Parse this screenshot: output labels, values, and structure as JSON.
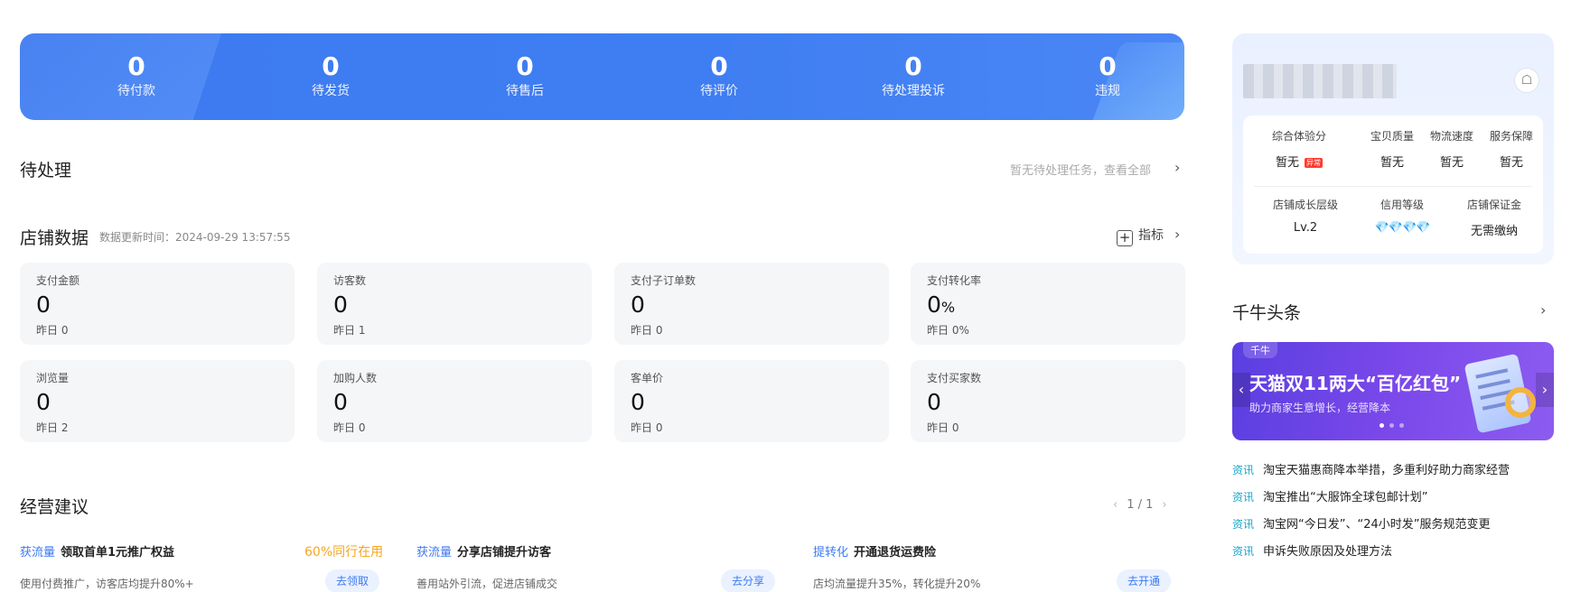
{
  "summary": [
    {
      "value": "0",
      "label": "待付款"
    },
    {
      "value": "0",
      "label": "待发货"
    },
    {
      "value": "0",
      "label": "待售后"
    },
    {
      "value": "0",
      "label": "待评价"
    },
    {
      "value": "0",
      "label": "待处理投诉"
    },
    {
      "value": "0",
      "label": "违规"
    }
  ],
  "pending": {
    "title": "待处理",
    "link": "暂无待处理任务，查看全部"
  },
  "store_data": {
    "title": "店铺数据",
    "update_time": "数据更新时间：2024-09-29 13:57:55",
    "metric_button": "指标",
    "cards": [
      {
        "title": "支付金额",
        "value": "0",
        "unit": "",
        "yesterday": "昨日 0"
      },
      {
        "title": "访客数",
        "value": "0",
        "unit": "",
        "yesterday": "昨日 1"
      },
      {
        "title": "支付子订单数",
        "value": "0",
        "unit": "",
        "yesterday": "昨日 0"
      },
      {
        "title": "支付转化率",
        "value": "0",
        "unit": "%",
        "yesterday": "昨日 0%"
      },
      {
        "title": "浏览量",
        "value": "0",
        "unit": "",
        "yesterday": "昨日 2"
      },
      {
        "title": "加购人数",
        "value": "0",
        "unit": "",
        "yesterday": "昨日 0"
      },
      {
        "title": "客单价",
        "value": "0",
        "unit": "",
        "yesterday": "昨日 0"
      },
      {
        "title": "支付买家数",
        "value": "0",
        "unit": "",
        "yesterday": "昨日 0"
      }
    ]
  },
  "suggestions": {
    "title": "经营建议",
    "pager": "1 / 1",
    "items": [
      {
        "tag": "获流量",
        "title": "领取首单1元推广权益",
        "hot": "60%同行在用",
        "desc": "使用付费推广，访客店均提升80%+",
        "button": "去领取"
      },
      {
        "tag": "获流量",
        "title": "分享店铺提升访客",
        "hot": "",
        "desc": "善用站外引流，促进店铺成交",
        "button": "去分享"
      },
      {
        "tag": "提转化",
        "title": "开通退货运费险",
        "hot": "",
        "desc": "店均流量提升35%，转化提升20%",
        "button": "去开通"
      }
    ]
  },
  "shop_scores": {
    "row1": [
      {
        "key": "综合体验分",
        "value": "暂无",
        "badge": "异常"
      },
      {
        "key": "宝贝质量",
        "value": "暂无"
      },
      {
        "key": "物流速度",
        "value": "暂无"
      },
      {
        "key": "服务保障",
        "value": "暂无"
      }
    ],
    "row2": [
      {
        "key": "店铺成长层级",
        "value": "Lv.2"
      },
      {
        "key": "信用等级",
        "value": "💎💎💎💎"
      },
      {
        "key": "店铺保证金",
        "value": "无需缴纳"
      }
    ]
  },
  "news": {
    "title": "千牛头条",
    "banner": {
      "brand": "千牛",
      "headline": "天猫双11两大“百亿红包”",
      "sub": "助力商家生意增长，经营降本"
    },
    "items": [
      {
        "tag": "资讯",
        "text": "淘宝天猫惠商降本举措，多重利好助力商家经营"
      },
      {
        "tag": "资讯",
        "text": "淘宝推出“大服饰全球包邮计划”"
      },
      {
        "tag": "资讯",
        "text": "淘宝网“今日发”、“24小时发”服务规范变更"
      },
      {
        "tag": "资讯",
        "text": "申诉失败原因及处理方法"
      }
    ]
  },
  "colors": {
    "primary": "#3d7af0",
    "hot": "#f5a623",
    "success": "#2cc16e",
    "news_tag": "#1aa6c9"
  }
}
